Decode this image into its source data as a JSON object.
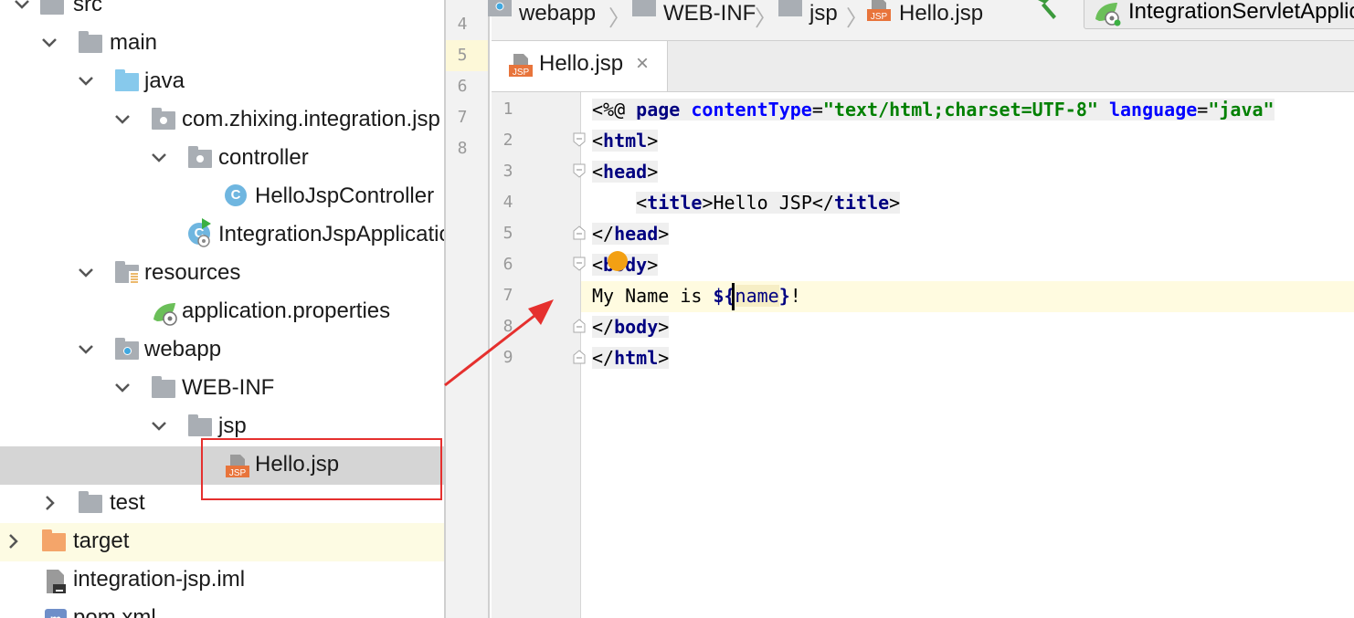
{
  "project_tree": {
    "items": [
      {
        "label": "src"
      },
      {
        "label": "main"
      },
      {
        "label": "java"
      },
      {
        "label": "com.zhixing.integration.jsp"
      },
      {
        "label": "controller"
      },
      {
        "label": "HelloJspController"
      },
      {
        "label": "IntegrationJspApplication"
      },
      {
        "label": "resources"
      },
      {
        "label": "application.properties"
      },
      {
        "label": "webapp"
      },
      {
        "label": "WEB-INF"
      },
      {
        "label": "jsp"
      },
      {
        "label": "Hello.jsp"
      },
      {
        "label": "test"
      },
      {
        "label": "target"
      },
      {
        "label": "integration-jsp.iml"
      },
      {
        "label": "pom.xml"
      }
    ],
    "class_badge": "C"
  },
  "side_gutter": {
    "line_numbers": [
      "4",
      "5",
      "6",
      "7",
      "8"
    ]
  },
  "navbar": {
    "crumbs": [
      "webapp",
      "WEB-INF",
      "jsp",
      "Hello.jsp"
    ],
    "run_config": "IntegrationServletApplication",
    "jsp_badge": "JSP"
  },
  "tabs": [
    {
      "label": "Hello.jsp",
      "close": "×"
    }
  ],
  "editor": {
    "line_numbers": [
      "1",
      "2",
      "3",
      "4",
      "5",
      "6",
      "7",
      "8",
      "9"
    ],
    "line1": {
      "p1": "<%@ ",
      "p2": "page ",
      "p3": "contentType",
      "p4": "=",
      "p5": "\"text/html;charset=UTF-8\"",
      "p6": " ",
      "p7": "language",
      "p8": "=",
      "p9": "\"java\""
    },
    "line2": {
      "open": "<",
      "tag": "html",
      "close": ">"
    },
    "line3": {
      "open": "<",
      "tag": "head",
      "close": ">"
    },
    "line4": {
      "indent": "    ",
      "o1": "<",
      "tag1": "title",
      "c1": ">",
      "text": "Hello JSP",
      "o2": "</",
      "tag2": "title",
      "c2": ">"
    },
    "line5": {
      "open": "</",
      "tag": "head",
      "close": ">"
    },
    "line6": {
      "open": "<",
      "tag": "body",
      "close": ">"
    },
    "line7": {
      "text": "My Name is ",
      "el_open": "${",
      "el_var": "name",
      "el_close": "}",
      "tail": "!"
    },
    "line8": {
      "open": "</",
      "tag": "body",
      "close": ">"
    },
    "line9": {
      "open": "</",
      "tag": "html",
      "close": ">"
    }
  },
  "colors": {
    "keyword": "#000080",
    "string": "#008000",
    "attribute": "#0000ff",
    "highlight_red": "#e5302e",
    "selection": "#d5d5d5"
  }
}
